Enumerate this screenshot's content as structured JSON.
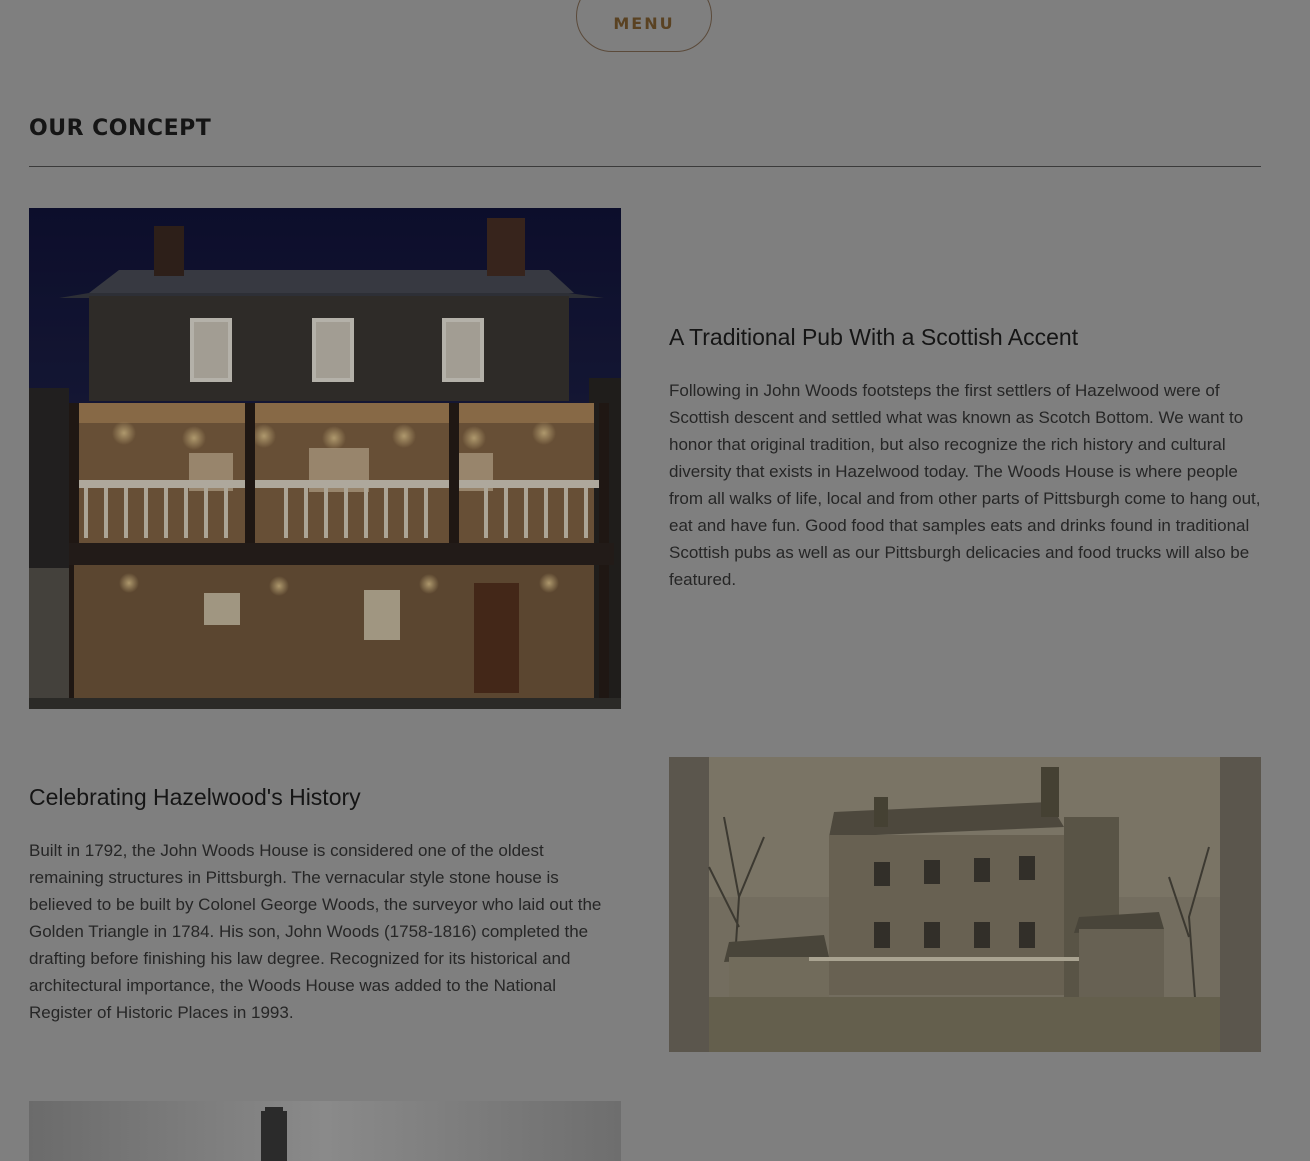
{
  "header": {
    "menu_label": "MENU"
  },
  "section": {
    "title": "OUR CONCEPT"
  },
  "blocks": [
    {
      "heading": "A Traditional Pub With a Scottish Accent",
      "text": "Following in John Woods footsteps the first settlers of Hazelwood were of Scottish descent and settled what was known as Scotch Bottom. We want to honor that original tradition, but also recognize the rich history and cultural diversity that exists in Hazelwood today. The Woods House is where people from all walks of life, local and from other parts of Pittsburgh come to hang out, eat and have fun. Good food that samples eats and drinks found in traditional Scottish pubs as well as our Pittsburgh delicacies and food trucks will also be featured."
    },
    {
      "heading": "Celebrating Hazelwood's History",
      "text": "Built in 1792, the John Woods House is considered one of the oldest remaining structures in Pittsburgh. The vernacular style stone house is believed to be built by Colonel George Woods, the surveyor who laid out the Golden Triangle in 1784. His son, John Woods (1758-1816) completed the drafting before finishing his law degree. Recognized for its historical and architectural importance, the Woods House was added to the National Register of Historic Places in 1993."
    }
  ],
  "colors": {
    "overlay_background": "#7f7f7f",
    "menu_text": "#5a4222",
    "heading_text": "#151515",
    "body_text": "#262626"
  }
}
